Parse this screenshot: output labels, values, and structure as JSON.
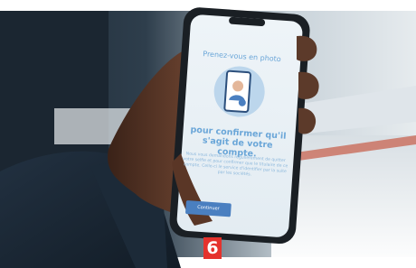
{
  "screen": {
    "title": "Prenez-vous en photo",
    "subtitle": "pour confirmer qu'il s'agit de votre compte.",
    "body": "Nous vous demandons régulièrement de quitter votre selfie et pour confirmer que le titulaire de ce compte. Celle-ci le service d'identifier par la suite par les sociétés.",
    "cta_label": "Continuer"
  },
  "badge_label": "6",
  "colors": {
    "phone_accent": "#4a7fc0",
    "badge_bg": "#e5322d",
    "sleeve": "#1a2735",
    "skin": "#4a2e20"
  }
}
